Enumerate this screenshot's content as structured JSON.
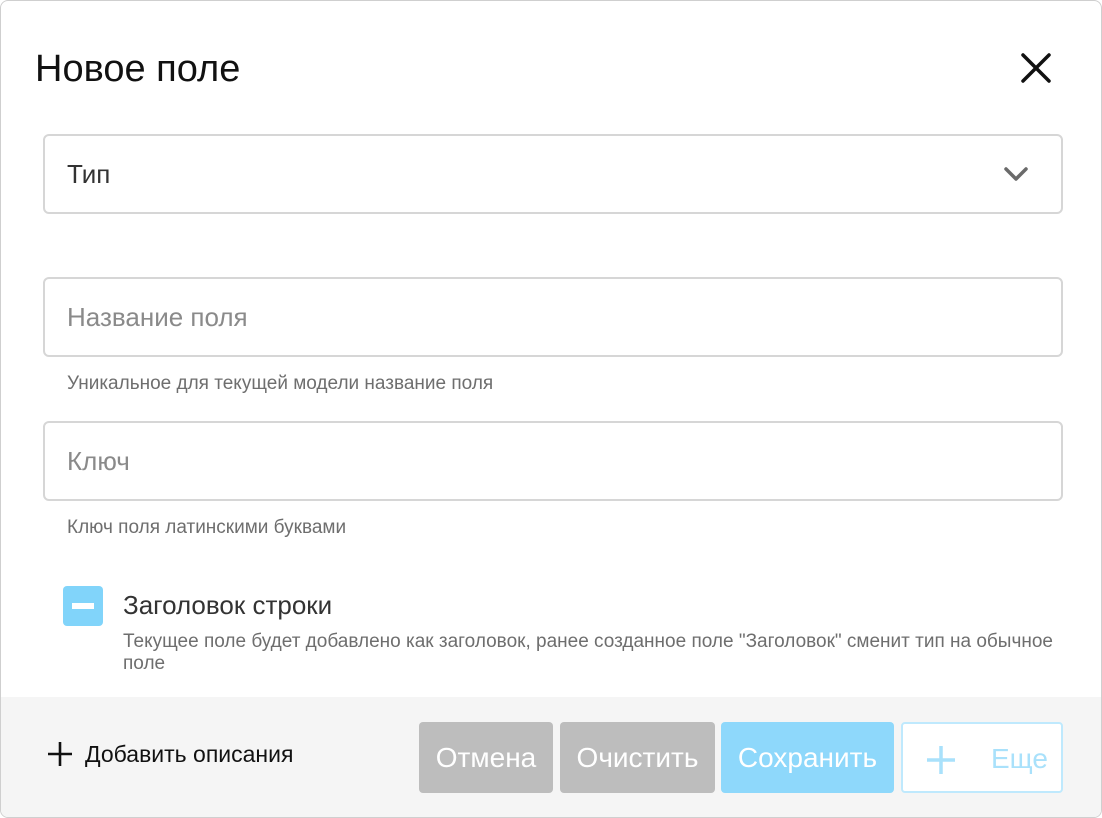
{
  "dialog": {
    "title": "Новое поле"
  },
  "type_select": {
    "value": "Тип"
  },
  "name_field": {
    "placeholder": "Название поля",
    "value": "",
    "helper": "Уникальное для текущей модели название поля"
  },
  "key_field": {
    "placeholder": "Ключ",
    "value": "",
    "helper": "Ключ поля латинскими буквами"
  },
  "row_header": {
    "label": "Заголовок строки",
    "description": "Текущее поле будет добавлено как заголовок, ранее созданное поле \"Заголовок\" сменит тип на обычное поле"
  },
  "footer": {
    "add_descriptions_label": "Добавить описания",
    "cancel_label": "Отмена",
    "clear_label": "Очистить",
    "save_label": "Сохранить",
    "more_label": "Еще"
  },
  "icons": {
    "close": "close-icon",
    "chevron": "chevron-down-icon",
    "checkbox": "indeterminate-checkbox-icon",
    "add": "plus-icon"
  },
  "colors": {
    "accent": "#81d4fa",
    "button_disabled": "#bdbdbd",
    "footer_bg": "#f5f5f5"
  }
}
